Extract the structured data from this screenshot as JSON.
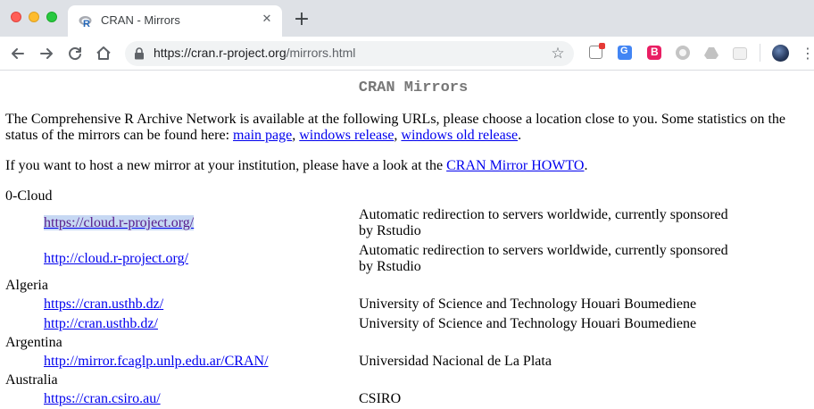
{
  "browser": {
    "tab": {
      "title": "CRAN - Mirrors",
      "close_glyph": "✕"
    },
    "new_tab_glyph": "+",
    "address": {
      "scheme_host": "https://cran.r-project.org",
      "path": "/mirrors.html"
    },
    "star_glyph": "☆",
    "menu_glyph": "⋮",
    "colors": {
      "tab_bar": "#dee1e6",
      "omnibox": "#f1f3f4",
      "link": "#0000ee",
      "visited_link": "#551a8b",
      "selection": "#c6d8f3"
    },
    "extensions": [
      "adblock-icon",
      "google-translate-icon",
      "extension-b-icon",
      "circle-extension-icon",
      "drive-extension-icon",
      "tab-extension-icon"
    ]
  },
  "page": {
    "heading": "CRAN Mirrors",
    "intro": {
      "text_before": "The Comprehensive R Archive Network is available at the following URLs, please choose a location close to you. Some statistics on the status of the mirrors can be found here: ",
      "link_main": "main page",
      "sep1": ", ",
      "link_windows": "windows release",
      "sep2": ", ",
      "link_windows_old": "windows old release",
      "text_after": "."
    },
    "host": {
      "text_before": "If you want to host a new mirror at your institution, please have a look at the ",
      "link": "CRAN Mirror HOWTO",
      "text_after": "."
    },
    "groups": [
      {
        "country": "0-Cloud",
        "mirrors": [
          {
            "url": "https://cloud.r-project.org/",
            "desc": "Automatic redirection to servers worldwide, currently sponsored by Rstudio"
          },
          {
            "url": "http://cloud.r-project.org/",
            "desc": "Automatic redirection to servers worldwide, currently sponsored by Rstudio"
          }
        ]
      },
      {
        "country": "Algeria",
        "mirrors": [
          {
            "url": "https://cran.usthb.dz/",
            "desc": "University of Science and Technology Houari Boumediene"
          },
          {
            "url": "http://cran.usthb.dz/",
            "desc": "University of Science and Technology Houari Boumediene"
          }
        ]
      },
      {
        "country": "Argentina",
        "mirrors": [
          {
            "url": "http://mirror.fcaglp.unlp.edu.ar/CRAN/",
            "desc": "Universidad Nacional de La Plata"
          }
        ]
      },
      {
        "country": "Australia",
        "mirrors": [
          {
            "url": "https://cran.csiro.au/",
            "desc": "CSIRO"
          }
        ]
      }
    ]
  }
}
